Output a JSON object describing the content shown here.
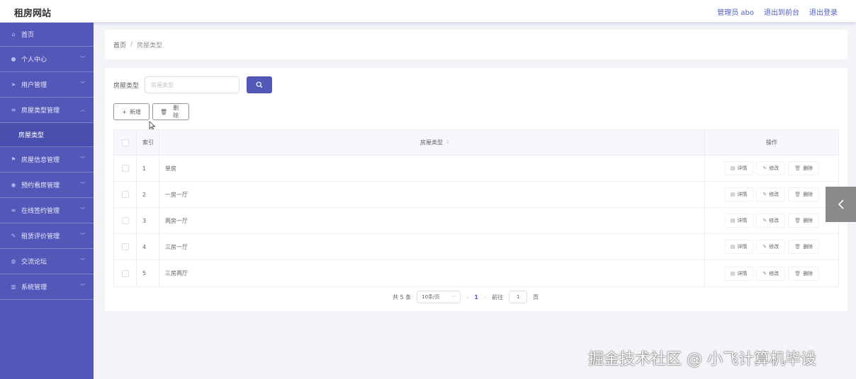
{
  "header": {
    "brand": "租房网站",
    "admin_label": "管理员 abo",
    "exit_to_front": "退出到前台",
    "logout": "退出登录"
  },
  "sidebar": {
    "items": [
      {
        "label": "首页",
        "icon": "home-icon"
      },
      {
        "label": "个人中心",
        "icon": "user-icon"
      },
      {
        "label": "用户管理",
        "icon": "send-icon"
      },
      {
        "label": "房屋类型管理",
        "icon": "list-icon"
      },
      {
        "label": "房屋类型",
        "icon": ""
      },
      {
        "label": "房屋信息管理",
        "icon": "flag-icon"
      },
      {
        "label": "预约看房管理",
        "icon": "location-icon"
      },
      {
        "label": "在线签约管理",
        "icon": "list-icon"
      },
      {
        "label": "租赁评价管理",
        "icon": "edit-icon"
      },
      {
        "label": "交流论坛",
        "icon": "chat-icon"
      },
      {
        "label": "系统管理",
        "icon": "chart-icon"
      }
    ]
  },
  "breadcrumb": {
    "home": "首页",
    "separator": "/",
    "current": "房屋类型"
  },
  "search": {
    "label": "房屋类型",
    "placeholder": "房屋类型"
  },
  "toolbar": {
    "add_label": "新增",
    "delete_label": "删除"
  },
  "table": {
    "headers": {
      "index": "索引",
      "type": "房屋类型",
      "ops": "操作"
    },
    "rows": [
      {
        "index": "1",
        "type": "单房"
      },
      {
        "index": "2",
        "type": "一房一厅"
      },
      {
        "index": "3",
        "type": "两房一厅"
      },
      {
        "index": "4",
        "type": "三房一厅"
      },
      {
        "index": "5",
        "type": "三房两厅"
      }
    ],
    "actions": {
      "detail": "详情",
      "edit": "修改",
      "delete": "删除"
    }
  },
  "pagination": {
    "total": "共 5 条",
    "page_size": "10条/页",
    "current_page": "1",
    "goto_label": "前往",
    "goto_value": "1",
    "page_suffix": "页"
  },
  "watermark": "掘金技术社区 @ 小飞计算机毕设",
  "colors": {
    "accent": "#5358b8",
    "sidebar_bg": "#5358b8"
  }
}
